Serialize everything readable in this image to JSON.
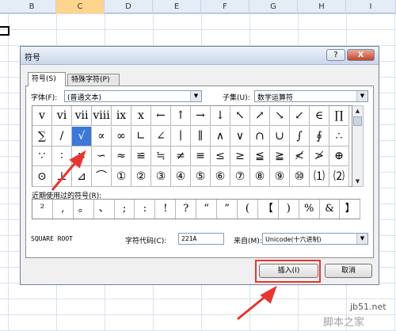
{
  "columns": [
    "B",
    "C",
    "D",
    "E",
    "F",
    "G",
    "H",
    "I"
  ],
  "dialog": {
    "title": "符号",
    "help_label": "?",
    "close_label": "X",
    "tabs": [
      "符号(S)",
      "特殊字符(P)"
    ],
    "font_label": "字体(F):",
    "font_value": "(普通文本)",
    "subset_label": "子集(U):",
    "subset_value": "数学运算符",
    "symbols": [
      [
        "v",
        "vi",
        "vii",
        "viii",
        "ix",
        "x",
        "←",
        "↑",
        "→",
        "↓",
        "↖",
        "↗",
        "↘",
        "↙",
        "∈",
        "∏"
      ],
      [
        "∑",
        "/",
        "√",
        "∝",
        "∞",
        "∟",
        "∠",
        "∣",
        "∥",
        "∧",
        "∨",
        "∩",
        "∪",
        "∫",
        "∮",
        "∴"
      ],
      [
        "∵",
        "∶",
        "∷",
        "∽",
        "≈",
        "≌",
        "≒",
        "≠",
        "≡",
        "≤",
        "≥",
        "≦",
        "≧",
        "≮",
        "≯",
        "⊕"
      ],
      [
        "⊙",
        "⊥",
        "⊿",
        "⌒",
        "①",
        "②",
        "③",
        "④",
        "⑤",
        "⑥",
        "⑦",
        "⑧",
        "⑨",
        "⑩",
        "⑴",
        "⑵"
      ]
    ],
    "selected_symbol": "√",
    "recent_label": "近期使用过的符号(R):",
    "recent_symbols": [
      "²",
      ",",
      "。",
      "、",
      ";",
      ":",
      "!",
      "?",
      "“",
      "”",
      "(",
      "【",
      ")",
      "%",
      "&",
      "】"
    ],
    "char_name": "SQUARE ROOT",
    "char_code_label": "字符代码(C):",
    "char_code_value": "221A",
    "from_label": "来自(M):",
    "from_value": "Unicode(十六进制)",
    "insert_label": "插入(I)",
    "cancel_label": "取消"
  },
  "watermark": {
    "line1": "jb51.net",
    "line2": "脚本之家"
  },
  "colors": {
    "selection": "#3b78d8",
    "highlight": "#e8352f"
  }
}
